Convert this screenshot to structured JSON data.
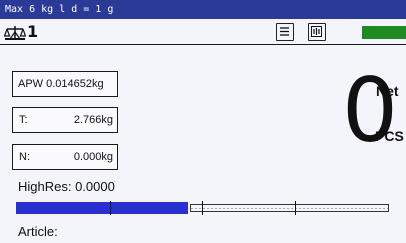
{
  "header": {
    "capacity_text": "Max 6 kg  l d = 1 g"
  },
  "status": {
    "scale_icon": "scale-balance-icon",
    "scale_number": "1",
    "list_icon": "list-icon",
    "tare_icon": "tare-memory-icon",
    "battery_color": "#1f8a1f"
  },
  "info_boxes": {
    "apw": {
      "label": "APW",
      "value": "0.014652kg"
    },
    "tare": {
      "label": "T:",
      "value": "2.766kg"
    },
    "net": {
      "label": "N:",
      "value": "0.000kg"
    }
  },
  "display": {
    "main_value": "0",
    "net_label": "Net",
    "unit": "PCS"
  },
  "highres": {
    "text": "HighRes: 0.0000"
  },
  "progress": {
    "fill_fraction": 0.46,
    "fill_color": "#2a2fd0"
  },
  "article": {
    "label": "Article:"
  }
}
